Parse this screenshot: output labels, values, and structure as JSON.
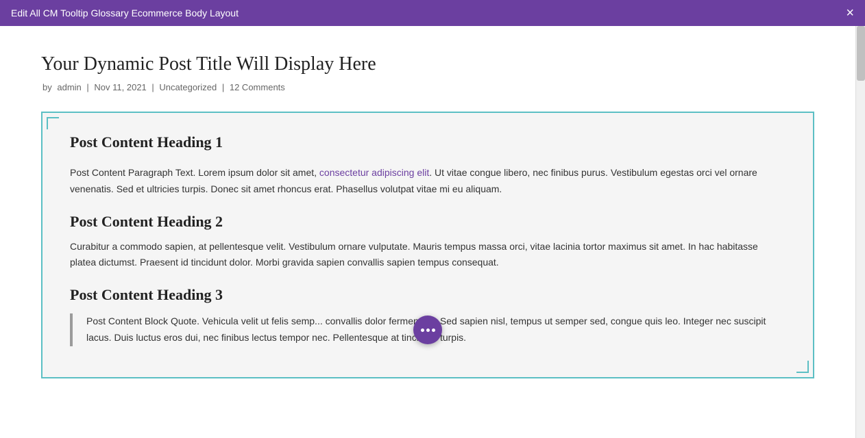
{
  "titlebar": {
    "label": "Edit All CM Tooltip Glossary Ecommerce Body Layout",
    "close_icon": "×"
  },
  "post": {
    "title": "Your Dynamic Post Title Will Display Here",
    "meta": {
      "prefix": "by",
      "author": "admin",
      "date": "Nov 11, 2021",
      "category": "Uncategorized",
      "comments": "12 Comments"
    }
  },
  "content": {
    "heading1": "Post Content Heading 1",
    "paragraph1_before_link": "Post Content Paragraph Text. Lorem ipsum dolor sit amet, ",
    "paragraph1_link": "consectetur adipiscing elit",
    "paragraph1_after_link": ". Ut vitae congue libero, nec finibus purus. Vestibulum egestas orci vel ornare venenatis. Sed et ultricies turpis. Donec sit amet rhoncus erat. Phasellus volutpat vitae mi eu aliquam.",
    "heading2": "Post Content Heading 2",
    "paragraph2": "Curabitur a commodo sapien, at pellentesque velit. Vestibulum ornare vulputate. Mauris tempus massa orci, vitae lacinia tortor maximus sit amet. In hac habitasse platea dictumst. Praesent id tincidunt dolor. Morbi gravida sapien convallis sapien tempus consequat.",
    "heading3": "Post Content Heading 3",
    "blockquote": "Post Content Block Quote. Vehicula velit ut felis semp... convallis dolor fermentum. Sed sapien nisl, tempus ut semper sed, congue quis leo. Integer nec suscipit lacus. Duis luctus eros dui, nec finibus lectus tempor nec. Pellentesque at tincidunt turpis."
  },
  "fab": {
    "dots": [
      "•",
      "•",
      "•"
    ]
  }
}
